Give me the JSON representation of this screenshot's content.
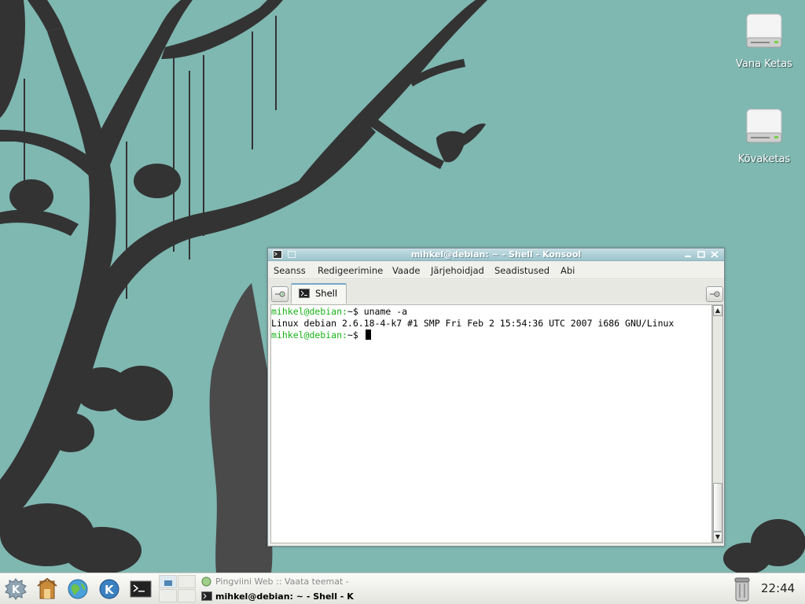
{
  "desktop": {
    "icons": [
      {
        "label": "Vana Ketas"
      },
      {
        "label": "Kõvaketas"
      }
    ]
  },
  "konsole": {
    "title": "mihkel@debian: ~ - Shell - Konsool",
    "menu": [
      "Seanss",
      "Redigeerimine",
      "Vaade",
      "Järjehoidjad",
      "Seadistused",
      "Abi"
    ],
    "tab_label": "Shell",
    "terminal": {
      "line1_prompt": "mihkel@debian:",
      "line1_rest": "~$ uname -a",
      "line2": "Linux debian 2.6.18-4-k7 #1 SMP Fri Feb 2 15:54:36 UTC 2007 i686 GNU/Linux",
      "line3_prompt": "mihkel@debian:",
      "line3_rest": "~$ "
    }
  },
  "taskbar": {
    "tasks": [
      {
        "label": "Pingviini Web :: Vaata teemat -",
        "active": false
      },
      {
        "label": "mihkel@debian: ~ - Shell - K",
        "active": true
      }
    ],
    "clock": "22:44"
  },
  "colors": {
    "desktop_bg": "#7fb7b1",
    "tree": "#333333",
    "prompt_green": "#18b218",
    "titlebar": "#9cc3cc"
  }
}
